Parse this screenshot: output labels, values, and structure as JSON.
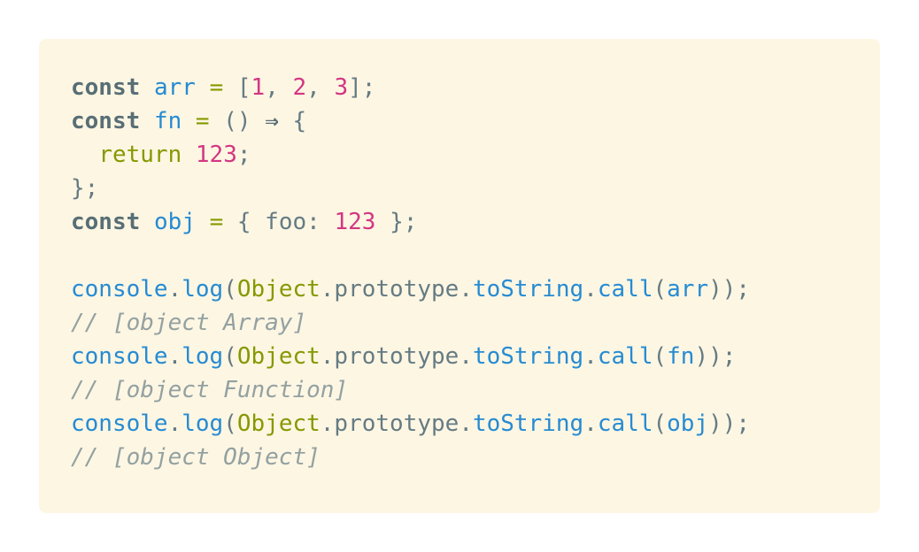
{
  "code": {
    "lines": [
      [
        {
          "text": "const",
          "cls": "kw-bold"
        },
        {
          "text": " ",
          "cls": "plain"
        },
        {
          "text": "arr",
          "cls": "var"
        },
        {
          "text": " ",
          "cls": "plain"
        },
        {
          "text": "=",
          "cls": "op"
        },
        {
          "text": " [",
          "cls": "punc"
        },
        {
          "text": "1",
          "cls": "num"
        },
        {
          "text": ", ",
          "cls": "punc"
        },
        {
          "text": "2",
          "cls": "num"
        },
        {
          "text": ", ",
          "cls": "punc"
        },
        {
          "text": "3",
          "cls": "num"
        },
        {
          "text": "];",
          "cls": "punc"
        }
      ],
      [
        {
          "text": "const",
          "cls": "kw-bold"
        },
        {
          "text": " ",
          "cls": "plain"
        },
        {
          "text": "fn",
          "cls": "var"
        },
        {
          "text": " ",
          "cls": "plain"
        },
        {
          "text": "=",
          "cls": "op"
        },
        {
          "text": " () ",
          "cls": "punc"
        },
        {
          "text": "⇒",
          "cls": "kw-bold"
        },
        {
          "text": " {",
          "cls": "punc"
        }
      ],
      [
        {
          "text": "  ",
          "cls": "plain"
        },
        {
          "text": "return",
          "cls": "kw-ret"
        },
        {
          "text": " ",
          "cls": "plain"
        },
        {
          "text": "123",
          "cls": "num"
        },
        {
          "text": ";",
          "cls": "punc"
        }
      ],
      [
        {
          "text": "};",
          "cls": "punc"
        }
      ],
      [
        {
          "text": "const",
          "cls": "kw-bold"
        },
        {
          "text": " ",
          "cls": "plain"
        },
        {
          "text": "obj",
          "cls": "var"
        },
        {
          "text": " ",
          "cls": "plain"
        },
        {
          "text": "=",
          "cls": "op"
        },
        {
          "text": " { foo: ",
          "cls": "punc"
        },
        {
          "text": "123",
          "cls": "num"
        },
        {
          "text": " };",
          "cls": "punc"
        }
      ],
      [],
      [
        {
          "text": "console",
          "cls": "var"
        },
        {
          "text": ".",
          "cls": "punc"
        },
        {
          "text": "log",
          "cls": "method"
        },
        {
          "text": "(",
          "cls": "punc"
        },
        {
          "text": "Object",
          "cls": "cls"
        },
        {
          "text": ".prototype.",
          "cls": "punc"
        },
        {
          "text": "toString",
          "cls": "method"
        },
        {
          "text": ".",
          "cls": "punc"
        },
        {
          "text": "call",
          "cls": "method"
        },
        {
          "text": "(",
          "cls": "punc"
        },
        {
          "text": "arr",
          "cls": "var"
        },
        {
          "text": "));",
          "cls": "punc"
        }
      ],
      [
        {
          "text": "// [object Array]",
          "cls": "comment"
        }
      ],
      [
        {
          "text": "console",
          "cls": "var"
        },
        {
          "text": ".",
          "cls": "punc"
        },
        {
          "text": "log",
          "cls": "method"
        },
        {
          "text": "(",
          "cls": "punc"
        },
        {
          "text": "Object",
          "cls": "cls"
        },
        {
          "text": ".prototype.",
          "cls": "punc"
        },
        {
          "text": "toString",
          "cls": "method"
        },
        {
          "text": ".",
          "cls": "punc"
        },
        {
          "text": "call",
          "cls": "method"
        },
        {
          "text": "(",
          "cls": "punc"
        },
        {
          "text": "fn",
          "cls": "var"
        },
        {
          "text": "));",
          "cls": "punc"
        }
      ],
      [
        {
          "text": "// [object Function]",
          "cls": "comment"
        }
      ],
      [
        {
          "text": "console",
          "cls": "var"
        },
        {
          "text": ".",
          "cls": "punc"
        },
        {
          "text": "log",
          "cls": "method"
        },
        {
          "text": "(",
          "cls": "punc"
        },
        {
          "text": "Object",
          "cls": "cls"
        },
        {
          "text": ".prototype.",
          "cls": "punc"
        },
        {
          "text": "toString",
          "cls": "method"
        },
        {
          "text": ".",
          "cls": "punc"
        },
        {
          "text": "call",
          "cls": "method"
        },
        {
          "text": "(",
          "cls": "punc"
        },
        {
          "text": "obj",
          "cls": "var"
        },
        {
          "text": "));",
          "cls": "punc"
        }
      ],
      [
        {
          "text": "// [object Object]",
          "cls": "comment"
        }
      ]
    ]
  },
  "colors": {
    "background": "#fdf6e3",
    "keyword": "#586e75",
    "variable": "#268bd2",
    "operator": "#859900",
    "number": "#d33682",
    "comment": "#93a1a1"
  }
}
